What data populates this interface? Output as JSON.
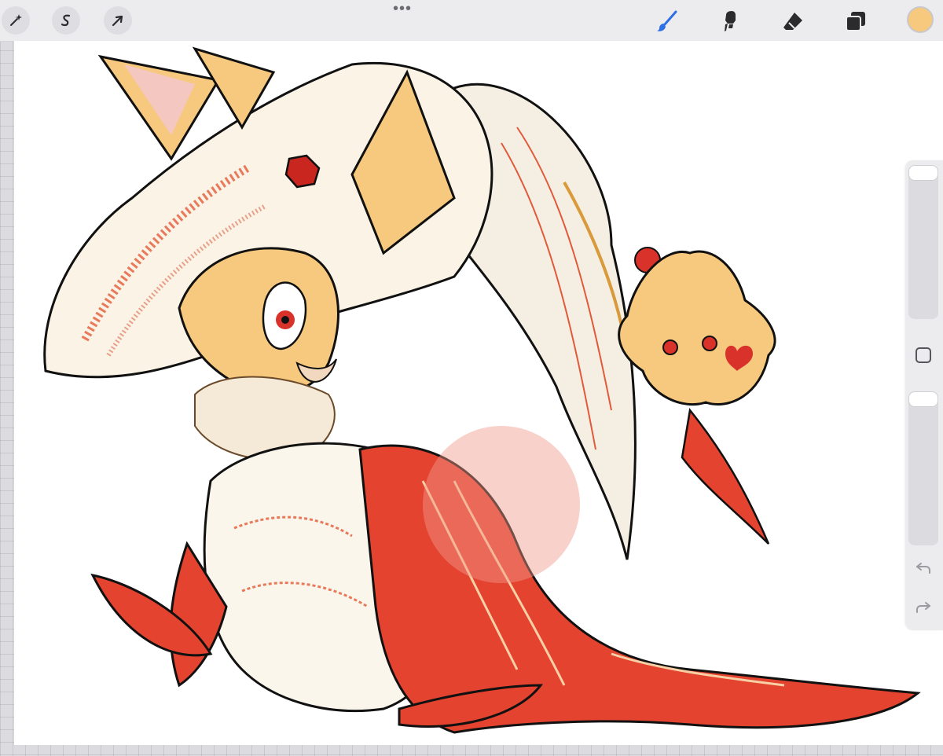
{
  "toolbar": {
    "left_tools": [
      {
        "name": "adjustments",
        "icon": "magic-wand-icon"
      },
      {
        "name": "selection",
        "icon": "selection-s-icon"
      },
      {
        "name": "transform",
        "icon": "arrow-cursor-icon"
      }
    ],
    "more_icon": "more-dots-icon",
    "right_tools": [
      {
        "name": "brush",
        "icon": "brush-icon",
        "active": true
      },
      {
        "name": "smudge",
        "icon": "smudge-icon"
      },
      {
        "name": "eraser",
        "icon": "eraser-icon"
      },
      {
        "name": "layers",
        "icon": "layers-icon"
      }
    ],
    "current_color": "#F7C97E"
  },
  "colors": {
    "active_tool": "#2F6FE6",
    "inactive_tool": "#2B2B2E"
  },
  "sidebar": {
    "brush_size_level": 0.0,
    "opacity_level": 0.0,
    "undo_icon": "undo-icon",
    "redo_icon": "redo-icon",
    "modify_icon": "square-modify-icon"
  }
}
